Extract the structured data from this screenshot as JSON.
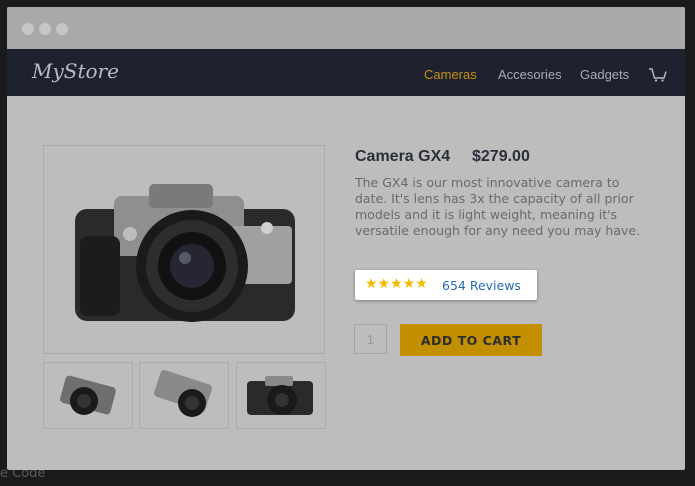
{
  "window": {
    "dots": [
      "close",
      "minimize",
      "maximize"
    ]
  },
  "nav": {
    "logo": "MyStore",
    "links": [
      "Cameras",
      "Accesories",
      "Gadgets"
    ],
    "active": "Cameras",
    "cart_icon": "cart-icon"
  },
  "product": {
    "title": "Camera GX4",
    "price": "$279.00",
    "description": "The GX4 is our most innovative camera to date. It's lens has 3x the capacity of all prior models and it is light weight, meaning it's versatile enough for any need you may have.",
    "rating": {
      "stars_text": "★★★★★",
      "star_count": 5,
      "reviews_label": "654 Reviews"
    },
    "quantity": "1",
    "add_to_cart_label": "ADD TO CART"
  },
  "background": {
    "caption": "e Code"
  },
  "colors": {
    "navbar": "#1e2230",
    "accent": "#c8940c",
    "button": "#c18f00",
    "link": "#2b6bb2",
    "star": "#f5b800"
  }
}
